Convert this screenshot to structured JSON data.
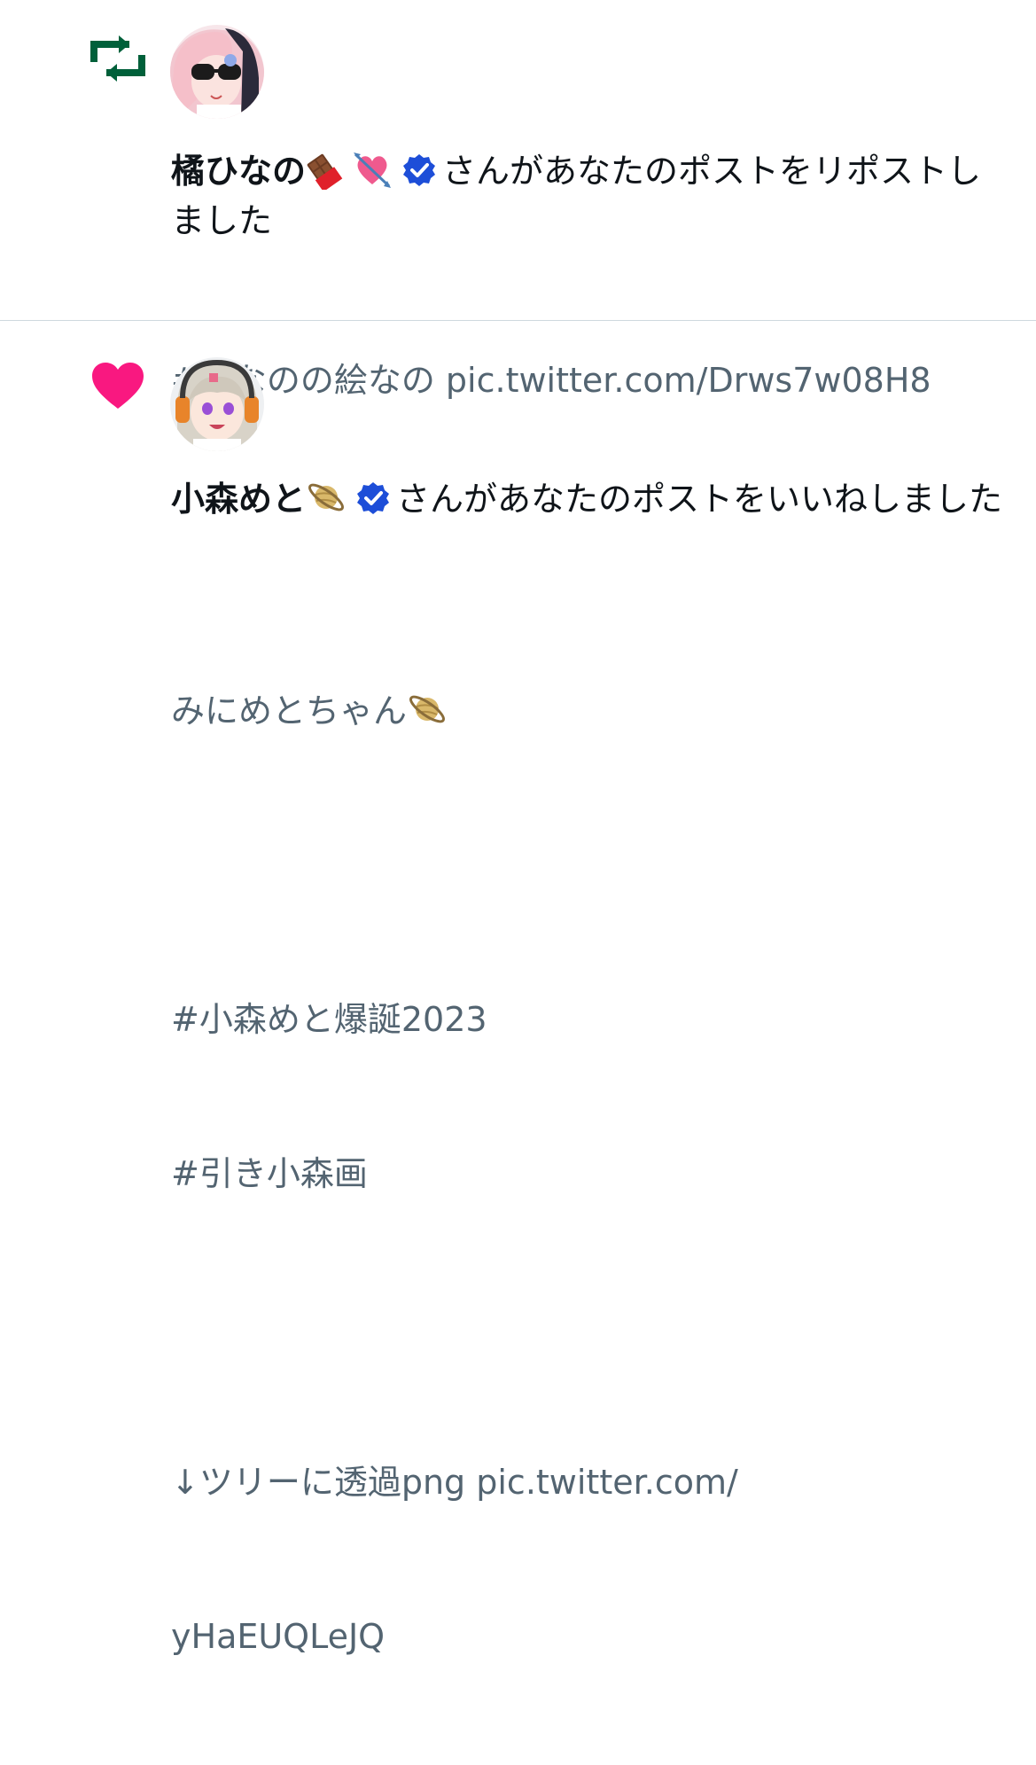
{
  "notifications": [
    {
      "type": "repost",
      "type_icon": "repost-icon",
      "type_color": "#00603a",
      "avatar": "avatar-tachibana-hinano",
      "user_name": "橘ひなの",
      "name_emojis": [
        "chocolate-bar-emoji",
        "heart-with-arrow-emoji"
      ],
      "verified": true,
      "action_text": "さんがあなたのポストをリポストしました",
      "post_lines": [
        "#ひなのの絵なの pic.twitter.com/Drws7w08H8"
      ]
    },
    {
      "type": "like",
      "type_icon": "heart-icon",
      "type_color": "#f91880",
      "avatar": "avatar-komori-met",
      "user_name": "小森めと",
      "name_emojis": [
        "ringed-planet-emoji"
      ],
      "verified": true,
      "action_text": "さんがあなたのポストをいいねしました",
      "post_lines": [
        "みにめとちゃん",
        "",
        "#小森めと爆誕2023",
        "#引き小森画",
        "",
        "↓ツリーに透過png pic.twitter.com/",
        "yHaEUQLeJQ"
      ],
      "post_emoji_after_line_0": "ringed-planet-emoji"
    }
  ],
  "colors": {
    "verified_blue": "#1d9bf0",
    "verified_badge": "#1d4ed8",
    "text_primary": "#0f1419",
    "text_secondary": "#536471",
    "divider": "#cfd9de"
  }
}
